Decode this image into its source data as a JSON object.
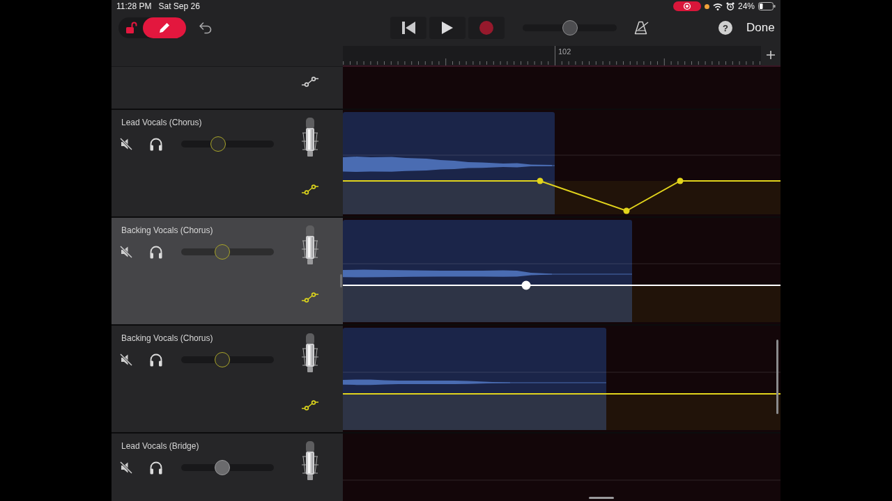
{
  "status_bar": {
    "time": "11:28 PM",
    "date": "Sat Sep 26",
    "battery": "24%"
  },
  "toolbar": {
    "edit_button": {
      "on": true
    },
    "master_volume": {
      "level": 0.5
    },
    "help": "?",
    "done": "Done"
  },
  "ruler": {
    "marker": "102"
  },
  "tracks": [
    {
      "kind": "bottom",
      "automation": false,
      "selected": false
    },
    {
      "kind": "full",
      "name": "Lead Vocals (Chorus)",
      "level": 0.4,
      "automation": true,
      "selected": false
    },
    {
      "kind": "full",
      "name": "Backing Vocals (Chorus)",
      "level": 0.44,
      "automation": true,
      "selected": true
    },
    {
      "kind": "full",
      "name": "Backing Vocals (Chorus)",
      "level": 0.44,
      "automation": true,
      "selected": false
    },
    {
      "kind": "top",
      "name": "Lead Vocals (Bridge)",
      "level": 0.44,
      "automation": false,
      "selected": false
    }
  ]
}
